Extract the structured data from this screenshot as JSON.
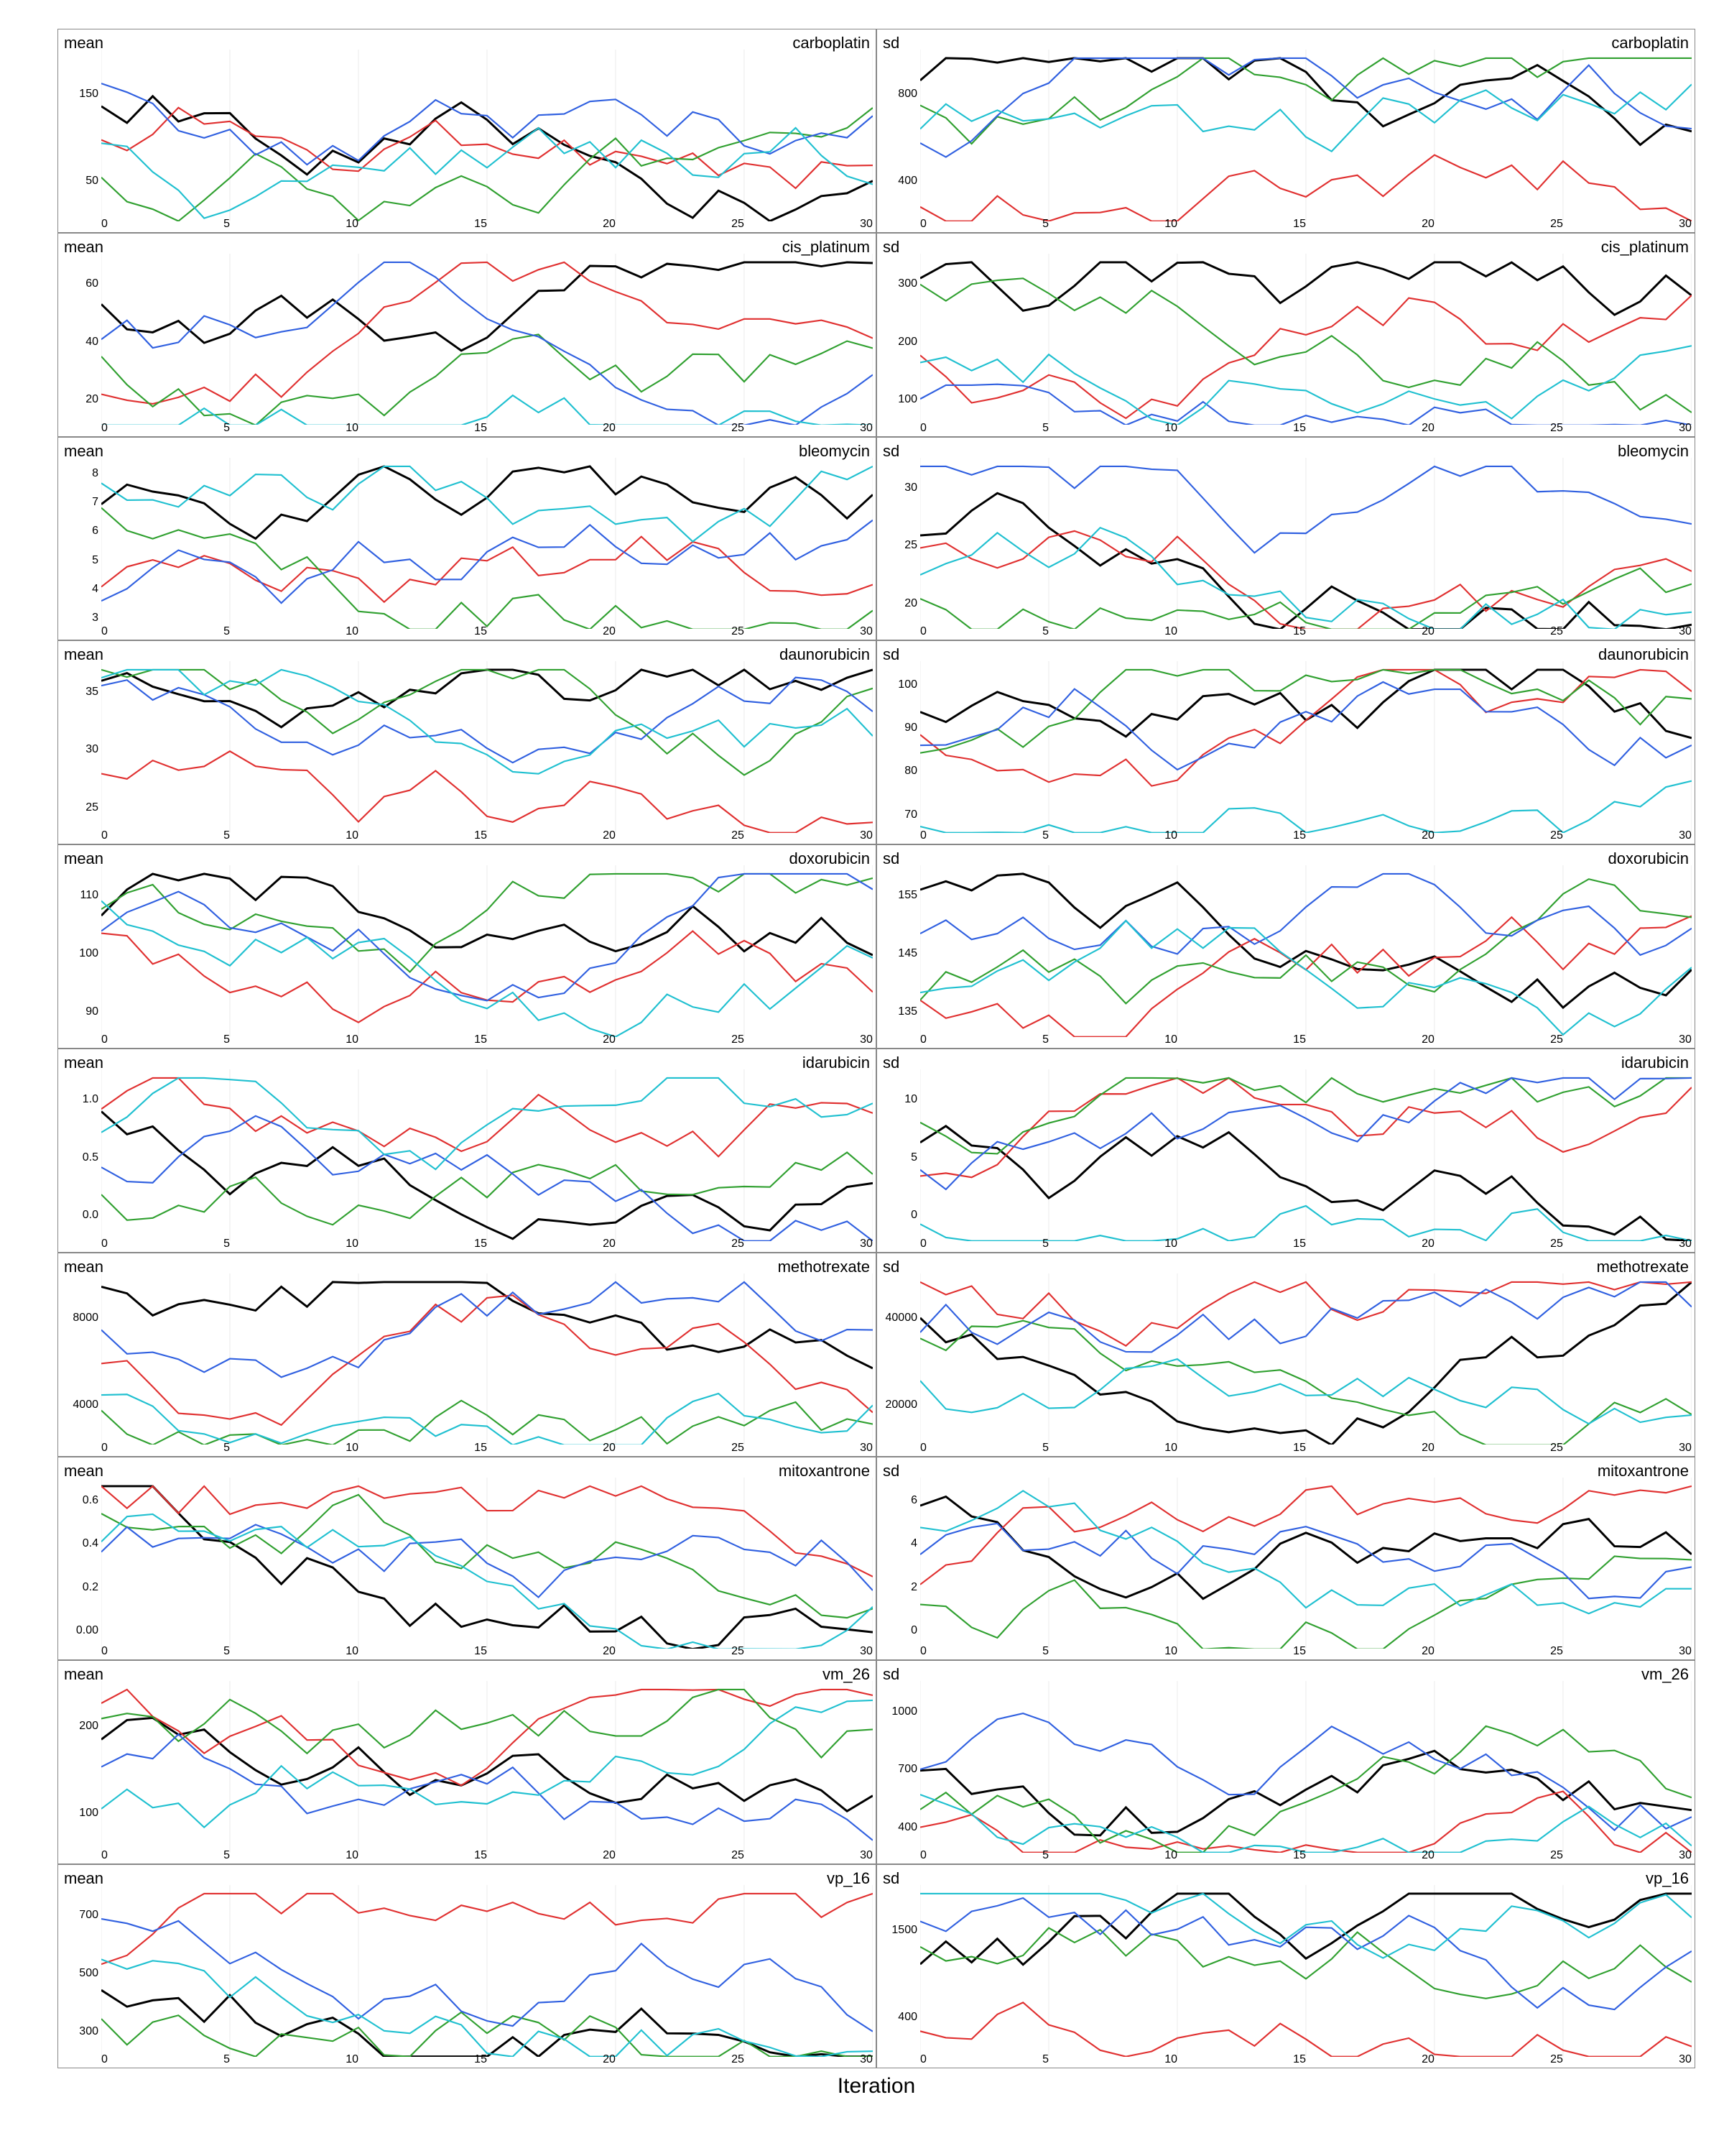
{
  "charts": [
    {
      "id": "mean-carboplatin",
      "type": "mean",
      "drug": "carboplatin",
      "yLabels": [
        "150",
        "50"
      ],
      "col": 0,
      "row": 0
    },
    {
      "id": "sd-carboplatin",
      "type": "sd",
      "drug": "carboplatin",
      "yLabels": [
        "800",
        "400"
      ],
      "col": 1,
      "row": 0
    },
    {
      "id": "mean-cis_platinum",
      "type": "mean",
      "drug": "cis_platinum",
      "yLabels": [
        "60",
        "40",
        "20"
      ],
      "col": 0,
      "row": 1
    },
    {
      "id": "sd-cis_platinum",
      "type": "sd",
      "drug": "cis_platinum",
      "yLabels": [
        "300",
        "200",
        "100"
      ],
      "col": 1,
      "row": 1
    },
    {
      "id": "mean-bleomycin",
      "type": "mean",
      "drug": "bleomycin",
      "yLabels": [
        "8",
        "7",
        "6",
        "5",
        "4",
        "3"
      ],
      "col": 0,
      "row": 2
    },
    {
      "id": "sd-bleomycin",
      "type": "sd",
      "drug": "bleomycin",
      "yLabels": [
        "30",
        "25",
        "20"
      ],
      "col": 1,
      "row": 2
    },
    {
      "id": "mean-daunorubicin",
      "type": "mean",
      "drug": "daunorubicin",
      "yLabels": [
        "35",
        "30",
        "25"
      ],
      "col": 0,
      "row": 3
    },
    {
      "id": "sd-daunorubicin",
      "type": "sd",
      "drug": "daunorubicin",
      "yLabels": [
        "100",
        "90",
        "80",
        "70"
      ],
      "col": 1,
      "row": 3
    },
    {
      "id": "mean-doxorubicin",
      "type": "mean",
      "drug": "doxorubicin",
      "yLabels": [
        "110",
        "100",
        "90"
      ],
      "col": 0,
      "row": 4
    },
    {
      "id": "sd-doxorubicin",
      "type": "sd",
      "drug": "doxorubicin",
      "yLabels": [
        "155",
        "145",
        "135"
      ],
      "col": 1,
      "row": 4
    },
    {
      "id": "mean-idarubicin",
      "type": "mean",
      "drug": "idarubicin",
      "yLabels": [
        "1.0",
        "0.5",
        "0.0"
      ],
      "col": 0,
      "row": 5
    },
    {
      "id": "sd-idarubicin",
      "type": "sd",
      "drug": "idarubicin",
      "yLabels": [
        "10",
        "5",
        "0"
      ],
      "col": 1,
      "row": 5
    },
    {
      "id": "mean-methotrexate",
      "type": "mean",
      "drug": "methotrexate",
      "yLabels": [
        "8000",
        "4000"
      ],
      "col": 0,
      "row": 6
    },
    {
      "id": "sd-methotrexate",
      "type": "sd",
      "drug": "methotrexate",
      "yLabels": [
        "40000",
        "20000"
      ],
      "col": 1,
      "row": 6
    },
    {
      "id": "mean-mitoxantrone",
      "type": "mean",
      "drug": "mitoxantrone",
      "yLabels": [
        "0.6",
        "0.4",
        "0.2",
        "0.00"
      ],
      "col": 0,
      "row": 7
    },
    {
      "id": "sd-mitoxantrone",
      "type": "sd",
      "drug": "mitoxantrone",
      "yLabels": [
        "6",
        "4",
        "2",
        "0"
      ],
      "col": 1,
      "row": 7
    },
    {
      "id": "mean-vm_26",
      "type": "mean",
      "drug": "vm_26",
      "yLabels": [
        "200",
        "100"
      ],
      "col": 0,
      "row": 8
    },
    {
      "id": "sd-vm_26",
      "type": "sd",
      "drug": "vm_26",
      "yLabels": [
        "1000",
        "700",
        "400"
      ],
      "col": 1,
      "row": 8
    },
    {
      "id": "mean-vp_16",
      "type": "mean",
      "drug": "vp_16",
      "yLabels": [
        "700",
        "500",
        "300"
      ],
      "col": 0,
      "row": 9
    },
    {
      "id": "sd-vp_16",
      "type": "sd",
      "drug": "vp_16",
      "yLabels": [
        "1500",
        "400"
      ],
      "col": 1,
      "row": 9
    }
  ],
  "xLabels": [
    "0",
    "5",
    "10",
    "15",
    "20",
    "25",
    "30"
  ],
  "iterationLabel": "Iteration",
  "colors": {
    "black": "#000000",
    "red": "#e03030",
    "green": "#30a030",
    "blue": "#3060e0",
    "cyan": "#20c0d0"
  }
}
